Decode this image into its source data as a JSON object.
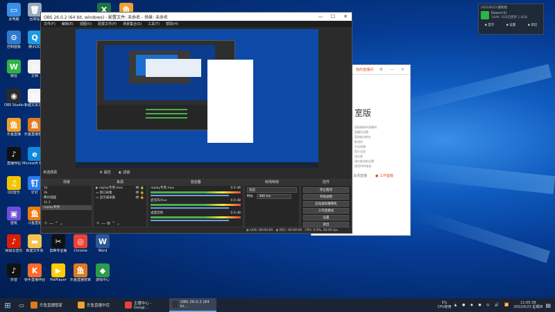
{
  "desktop_icons": [
    {
      "label": "此电脑",
      "color": "#3a8ee6",
      "glyph": "▭"
    },
    {
      "label": "回收站",
      "color": "#9aa9bf",
      "glyph": "🗑"
    },
    {
      "label": "控制面板",
      "color": "#2f7ad0",
      "glyph": "⚙"
    },
    {
      "label": "腾讯QQ",
      "color": "#1f9ae0",
      "glyph": "Q"
    },
    {
      "label": "微信",
      "color": "#2db543",
      "glyph": "W"
    },
    {
      "label": "文档",
      "color": "#f0f0f0",
      "glyph": "▤"
    },
    {
      "label": "OBS Studio",
      "color": "#2b2b2b",
      "glyph": "◉"
    },
    {
      "label": "新建文本文档",
      "color": "#f4f4f4",
      "glyph": "▤"
    },
    {
      "label": "乐鱼直播",
      "color": "#f0a030",
      "glyph": "鱼"
    },
    {
      "label": "乐鱼直播管家",
      "color": "#e07a20",
      "glyph": "鱼"
    },
    {
      "label": "直播伴侣",
      "color": "#111111",
      "glyph": "♪"
    },
    {
      "label": "Microsoft Edge",
      "color": "#0f8ad8",
      "glyph": "e"
    },
    {
      "label": "QQ音乐",
      "color": "#f5c400",
      "glyph": "♫"
    },
    {
      "label": "钉钉",
      "color": "#2a7cf0",
      "glyph": "钉"
    },
    {
      "label": "壁纸",
      "color": "#6a4ed8",
      "glyph": "▣"
    },
    {
      "label": "斗鱼直播",
      "color": "#ee7a10",
      "glyph": "鱼"
    },
    {
      "label": "网易云音乐",
      "color": "#d81e06",
      "glyph": "♪"
    },
    {
      "label": "新建文件夹",
      "color": "#f2c14e",
      "glyph": "▬"
    },
    {
      "label": "抖音",
      "color": "#111111",
      "glyph": "♪"
    },
    {
      "label": "快手直播伴侣",
      "color": "#ff6a2b",
      "glyph": "K"
    },
    {
      "label": "剪映专业版",
      "color": "#111111",
      "glyph": "✂"
    },
    {
      "label": "Chrome",
      "color": "#ea4335",
      "glyph": "◎"
    },
    {
      "label": "Word",
      "color": "#2b5797",
      "glyph": "W"
    },
    {
      "label": "PotPlayer",
      "color": "#ffcc00",
      "glyph": "▶"
    },
    {
      "label": "乐鱼直播管家",
      "color": "#e07a20",
      "glyph": "鱼"
    },
    {
      "label": "游戏中心",
      "color": "#2a9d4a",
      "glyph": "◆"
    },
    {
      "label": "Excel",
      "color": "#217346",
      "glyph": "X"
    },
    {
      "label": "乐鱼直播中控",
      "color": "#f0a030",
      "glyph": "鱼"
    }
  ],
  "obs": {
    "title": "OBS 26.0.2 (64 bit, windows) - 配置文件: 未命名 - 场景: 未命名",
    "menu": [
      "文件(F)",
      "编辑(E)",
      "视图(V)",
      "配置文件(P)",
      "场景集合(S)",
      "工具(T)",
      "帮助(H)"
    ],
    "status_label": "未选择源",
    "props_label": "属性",
    "filter_label": "滤镜",
    "scenes_header": "场景",
    "scenes": [
      "1k",
      "2k",
      "腾讯电脑",
      "1k 2",
      "replay专用"
    ],
    "sources_header": "来源",
    "sources": [
      "replay专用.mov",
      "窗口采集",
      "显示器采集"
    ],
    "mixer_header": "混音器",
    "mixer": [
      {
        "name": "replay专用.mov",
        "db": "0.0 dB"
      },
      {
        "name": "麦克风/Aux",
        "db": "0.0 dB"
      },
      {
        "name": "桌面音频",
        "db": "0.0 dB"
      }
    ],
    "transition_header": "转场特效",
    "transition_type": "淡出",
    "duration_label": "时长",
    "duration_value": "300 ms",
    "controls_header": "控件",
    "controls": [
      "停止推流",
      "开始录制",
      "启动虚拟摄像机",
      "工作室模式",
      "设置",
      "退出"
    ],
    "status": {
      "live": "LIVE: 00:00:00",
      "rec": "REC: 00:00:00",
      "cpu": "CPU: 0.9%, 60.00 fps"
    }
  },
  "bg_window": {
    "title": "我的直播间",
    "heading": "室版",
    "lines": [
      "获取最新的直播间",
      "直播间设置",
      "获取推流地址",
      "推流码",
      "开启直播",
      "提示信息",
      "请注意",
      "请在推流前设置",
      "使用OBS推流"
    ],
    "button_a": "关闭直播",
    "button_b": "工作室版"
  },
  "notification": {
    "title": "2022/6/23 最新版",
    "body": "Ekaorrr(1)",
    "sub": "24/M, 1GB已使用 1.6GB",
    "actions": [
      "显示",
      "设置",
      "退出"
    ]
  },
  "taskbar": {
    "apps": [
      {
        "label": "乐鱼直播管家",
        "color": "#e07a20"
      },
      {
        "label": "乐鱼直播中控",
        "color": "#f0a030"
      },
      {
        "label": "主播中心 - Googl...",
        "color": "#ea4335"
      },
      {
        "label": "OBS 26.0.2 (64 bi...",
        "color": "#333333"
      }
    ],
    "cpu_text": "5%",
    "cpu_label": "CPU使用",
    "time": "11:05:38",
    "date": "2022/6/23 星期四"
  }
}
